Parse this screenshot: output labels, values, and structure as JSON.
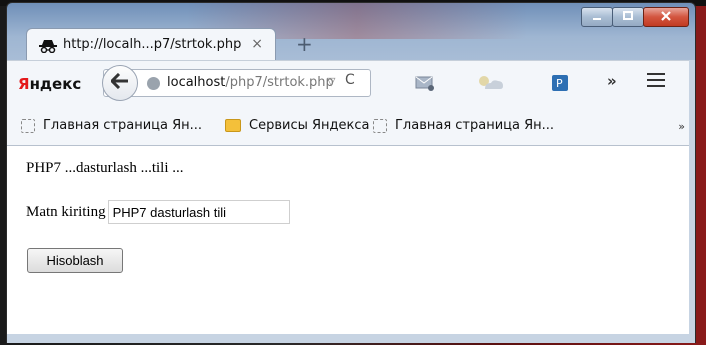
{
  "window": {
    "controls": {
      "minimize_icon": "minimize-icon",
      "maximize_icon": "maximize-icon",
      "close_icon": "close-icon"
    }
  },
  "tab": {
    "title": "http://localh...p7/strtok.php",
    "close_glyph": "×",
    "new_tab_glyph": "+"
  },
  "toolbar": {
    "yandex_logo_red": "Я",
    "yandex_logo_rest": "ндекс",
    "url_host": "localhost",
    "url_path": "/php7/strtok.php",
    "url_dropdown_glyph": "▽",
    "reload_glyph": "C",
    "overflow_glyph": "»"
  },
  "bookmarks": {
    "items": [
      {
        "label": "Главная страница Ян...",
        "icon": "page-icon"
      },
      {
        "label": "Сервисы Яндекса",
        "icon": "folder-icon"
      },
      {
        "label": "Главная страница Ян...",
        "icon": "page-icon"
      }
    ],
    "more_glyph": "»"
  },
  "page": {
    "result_text": "PHP7 ...dasturlash ...tili ...",
    "input_label": "Matn kiriting",
    "input_value": "PHP7 dasturlash tili",
    "submit_label": "Hisoblash"
  },
  "colors": {
    "yandex_red": "#e4191b",
    "close_button": "#c13a22"
  }
}
